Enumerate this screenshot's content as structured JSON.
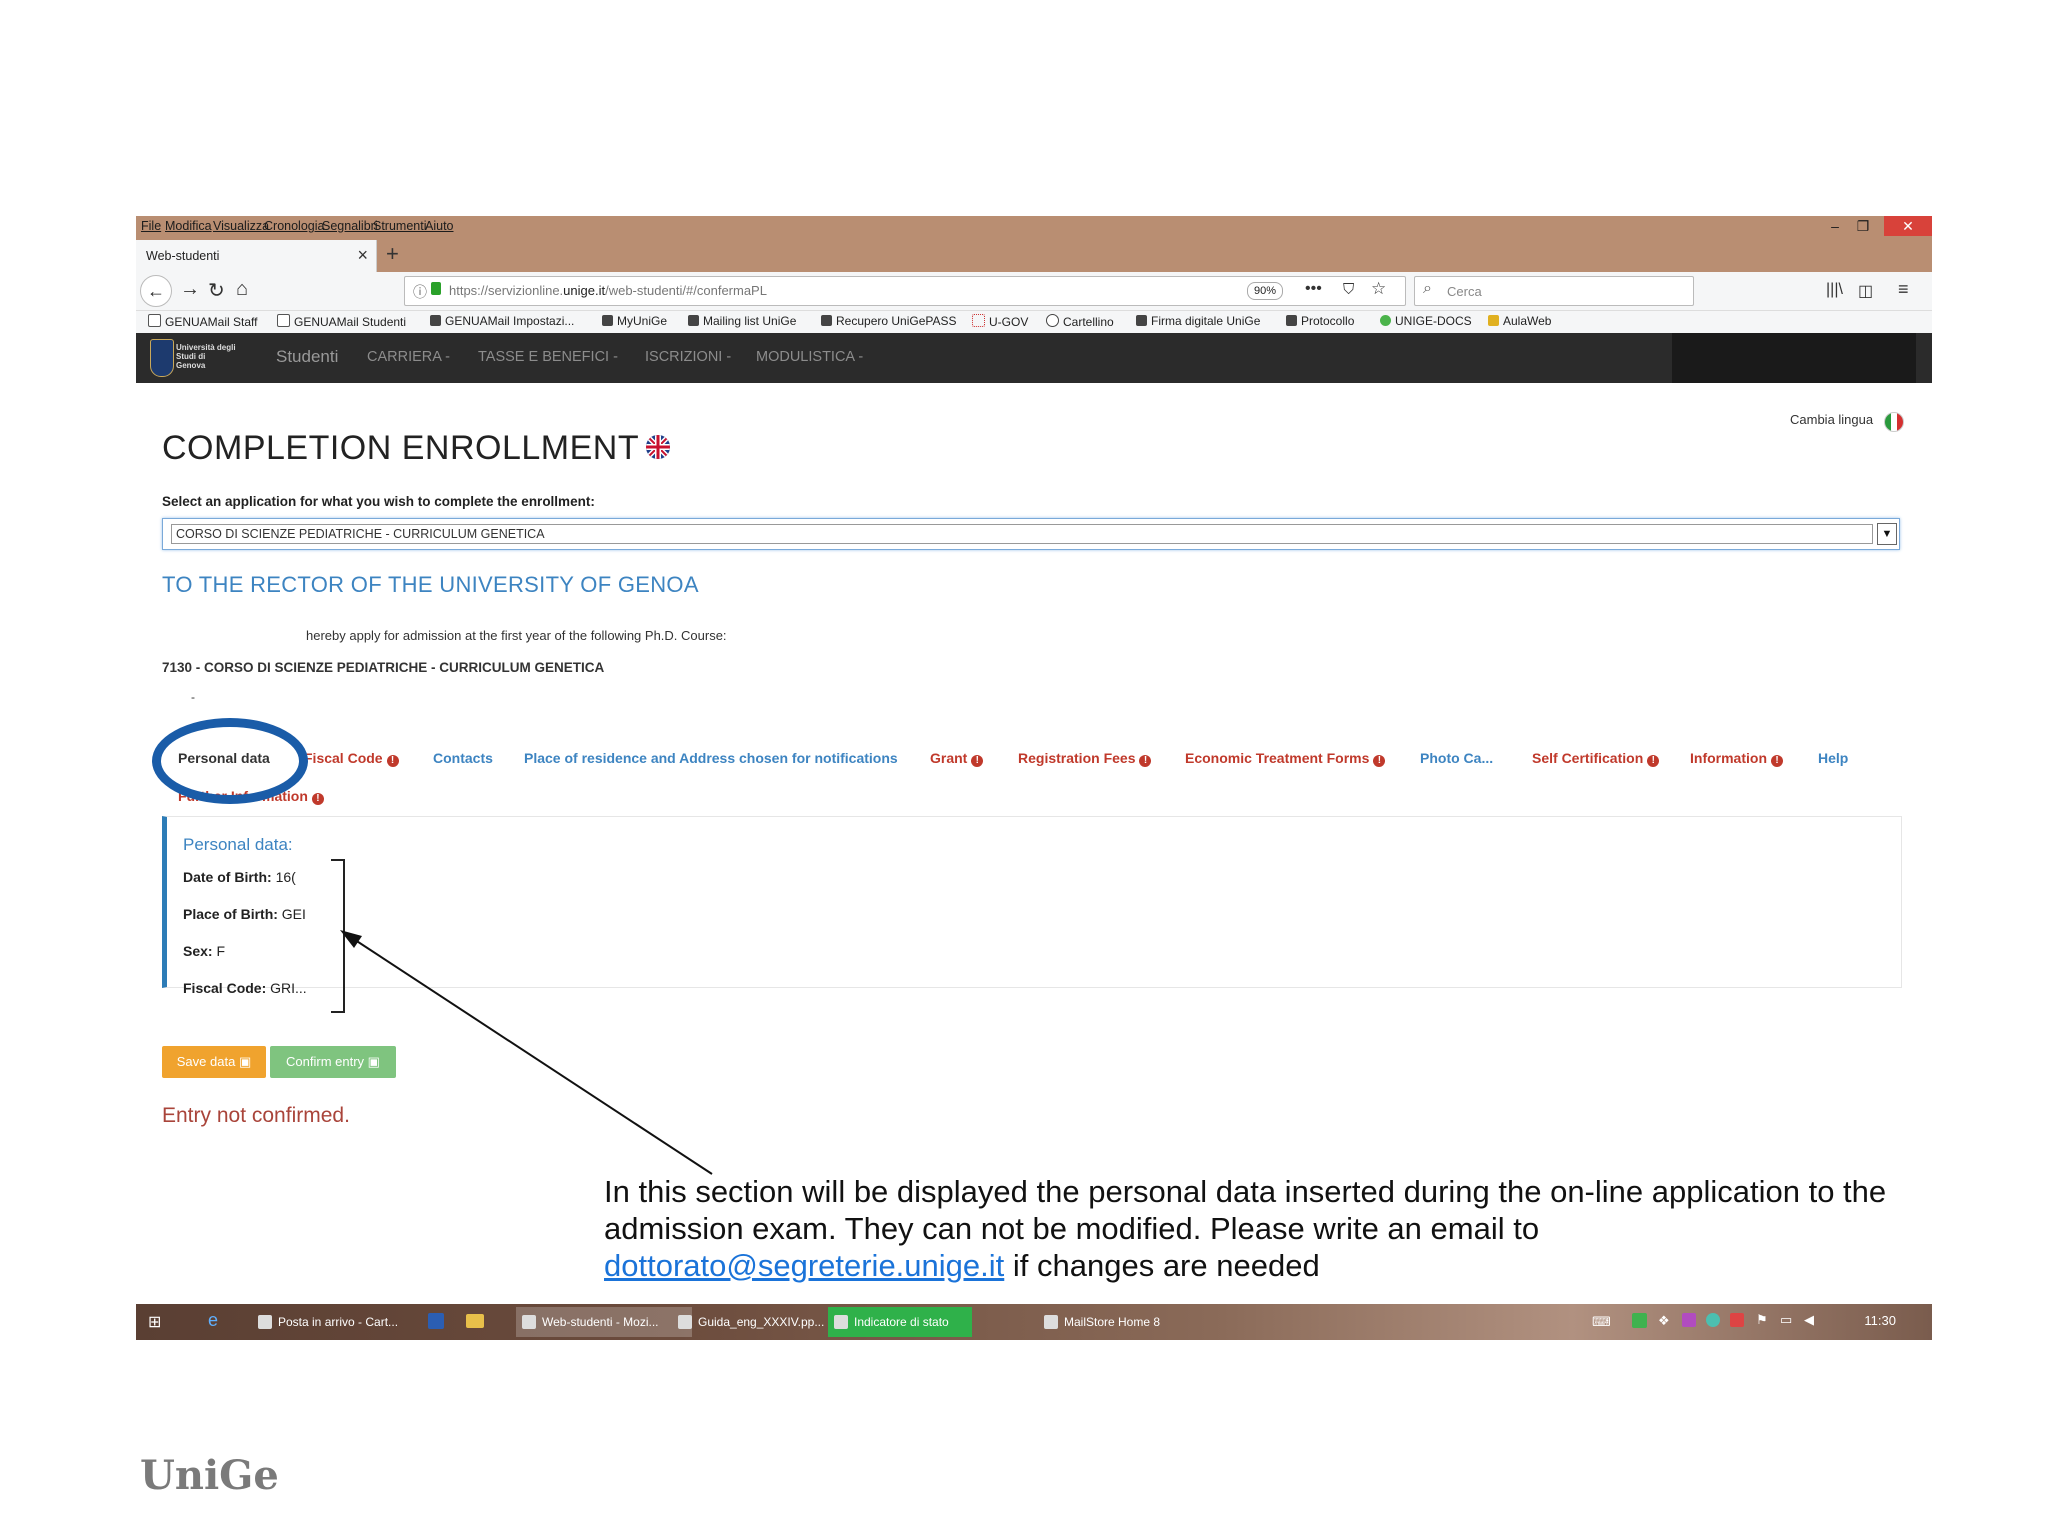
{
  "browser": {
    "menu": [
      "File",
      "Modifica",
      "Visualizza",
      "Cronologia",
      "Segnalibri",
      "Strumenti",
      "Aiuto"
    ],
    "tab_title": "Web-studenti",
    "url_prefix": "https://servizionline.",
    "url_domain": "unige.it",
    "url_path": "/web-studenti/#/confermaPL",
    "zoom": "90%",
    "search_placeholder": "Cerca",
    "bookmarks": [
      "GENUAMail Staff",
      "GENUAMail Studenti",
      "GENUAMail Impostazi...",
      "MyUniGe",
      "Mailing list UniGe",
      "Recupero UniGePASS",
      "U-GOV",
      "Cartellino",
      "Firma digitale UniGe",
      "Protocollo",
      "UNIGE-DOCS",
      "AulaWeb"
    ]
  },
  "site_nav": {
    "logo_text": "Università degli Studi di Genova",
    "brand": "Studenti",
    "items": [
      "CARRIERA -",
      "TASSE E BENEFICI -",
      "ISCRIZIONI -",
      "MODULISTICA -"
    ]
  },
  "page": {
    "language_label": "Cambia lingua",
    "title": "COMPLETION ENROLLMENT",
    "select_label": "Select an application for what you wish to complete the enrollment:",
    "select_value": "CORSO DI SCIENZE PEDIATRICHE - CURRICULUM GENETICA",
    "rector_heading": "TO THE RECTOR OF THE UNIVERSITY OF GENOA",
    "hereby_text": "hereby apply for admission at the first year of the following Ph.D. Course:",
    "course": "7130 - CORSO DI SCIENZE PEDIATRICHE - CURRICULUM GENETICA",
    "course_dash": "-"
  },
  "tabs": {
    "personal": "Personal data",
    "fiscal": "Fiscal Code",
    "contacts": "Contacts",
    "residence": "Place of residence and Address chosen for notifications",
    "grant": "Grant",
    "fees": "Registration Fees",
    "economic": "Economic Treatment Forms",
    "photo": "Photo Ca...",
    "selfcert": "Self Certification",
    "information": "Information",
    "help": "Help",
    "further": "Further Information"
  },
  "personal_panel": {
    "title": "Personal data:",
    "dob_label": "Date of Birth:",
    "dob_value": "16(",
    "pob_label": "Place of Birth:",
    "pob_value": "GEI",
    "sex_label": "Sex:",
    "sex_value": "F",
    "fiscal_label": "Fiscal Code:",
    "fiscal_value": "GRI..."
  },
  "actions": {
    "save": "Save data",
    "confirm": "Confirm entry",
    "status": "Entry not confirmed."
  },
  "taskbar": {
    "items": [
      "Posta in arrivo - Cart...",
      "Web-studenti - Mozi...",
      "Guida_eng_XXXIV.pp...",
      "Indicatore di stato",
      "MailStore Home 8"
    ],
    "clock": "11:30"
  },
  "annotation": {
    "text": "In this section will be displayed the personal data inserted during the on-line application to the admission exam. They can not be modified. Please write an email to",
    "email": "dottorato@segreterie.unige.it",
    "text_after": "if changes are needed"
  },
  "footer_logo": "UniGe",
  "colors": {
    "accent_blue": "#3d84c1",
    "required_red": "#c0392b",
    "save_orange": "#f0a32e",
    "confirm_green": "#7fc47f",
    "highlight_oval": "#1a5ca8"
  }
}
